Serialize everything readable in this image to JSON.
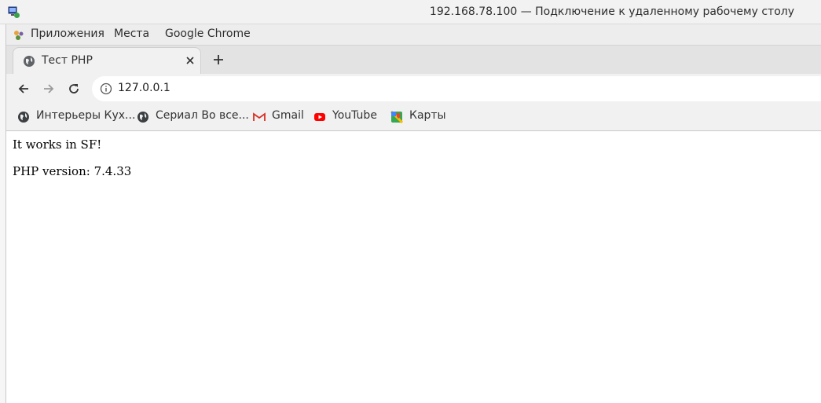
{
  "rdp_window": {
    "title": "192.168.78.100 — Подключение к удаленному рабочему столу"
  },
  "gnome_menu": {
    "items": [
      {
        "label": "Приложения",
        "icon": "apps-icon"
      },
      {
        "label": "Места"
      },
      {
        "label": "Google Chrome"
      }
    ]
  },
  "browser": {
    "tab": {
      "title": "Тест PHP",
      "favicon": "globe-icon"
    },
    "toolbar": {
      "back": "back-arrow-icon",
      "forward": "forward-arrow-icon",
      "reload": "reload-icon"
    },
    "address": {
      "url": "127.0.0.1",
      "icon": "info-icon"
    },
    "bookmarks": [
      {
        "label": "Интерьеры Кух...",
        "icon": "globe-icon"
      },
      {
        "label": "Сериал Во все...",
        "icon": "globe-icon"
      },
      {
        "label": "Gmail",
        "icon": "gmail-icon"
      },
      {
        "label": "YouTube",
        "icon": "youtube-icon"
      },
      {
        "label": "Карты",
        "icon": "maps-icon"
      }
    ]
  },
  "page": {
    "line1": "It works in SF!",
    "line2": "PHP version: 7.4.33"
  },
  "colors": {
    "youtube_red": "#ff0000",
    "gmail_red": "#d93025",
    "tab_bg": "#f1f1f1",
    "tabstrip_bg": "#e3e3e3"
  }
}
